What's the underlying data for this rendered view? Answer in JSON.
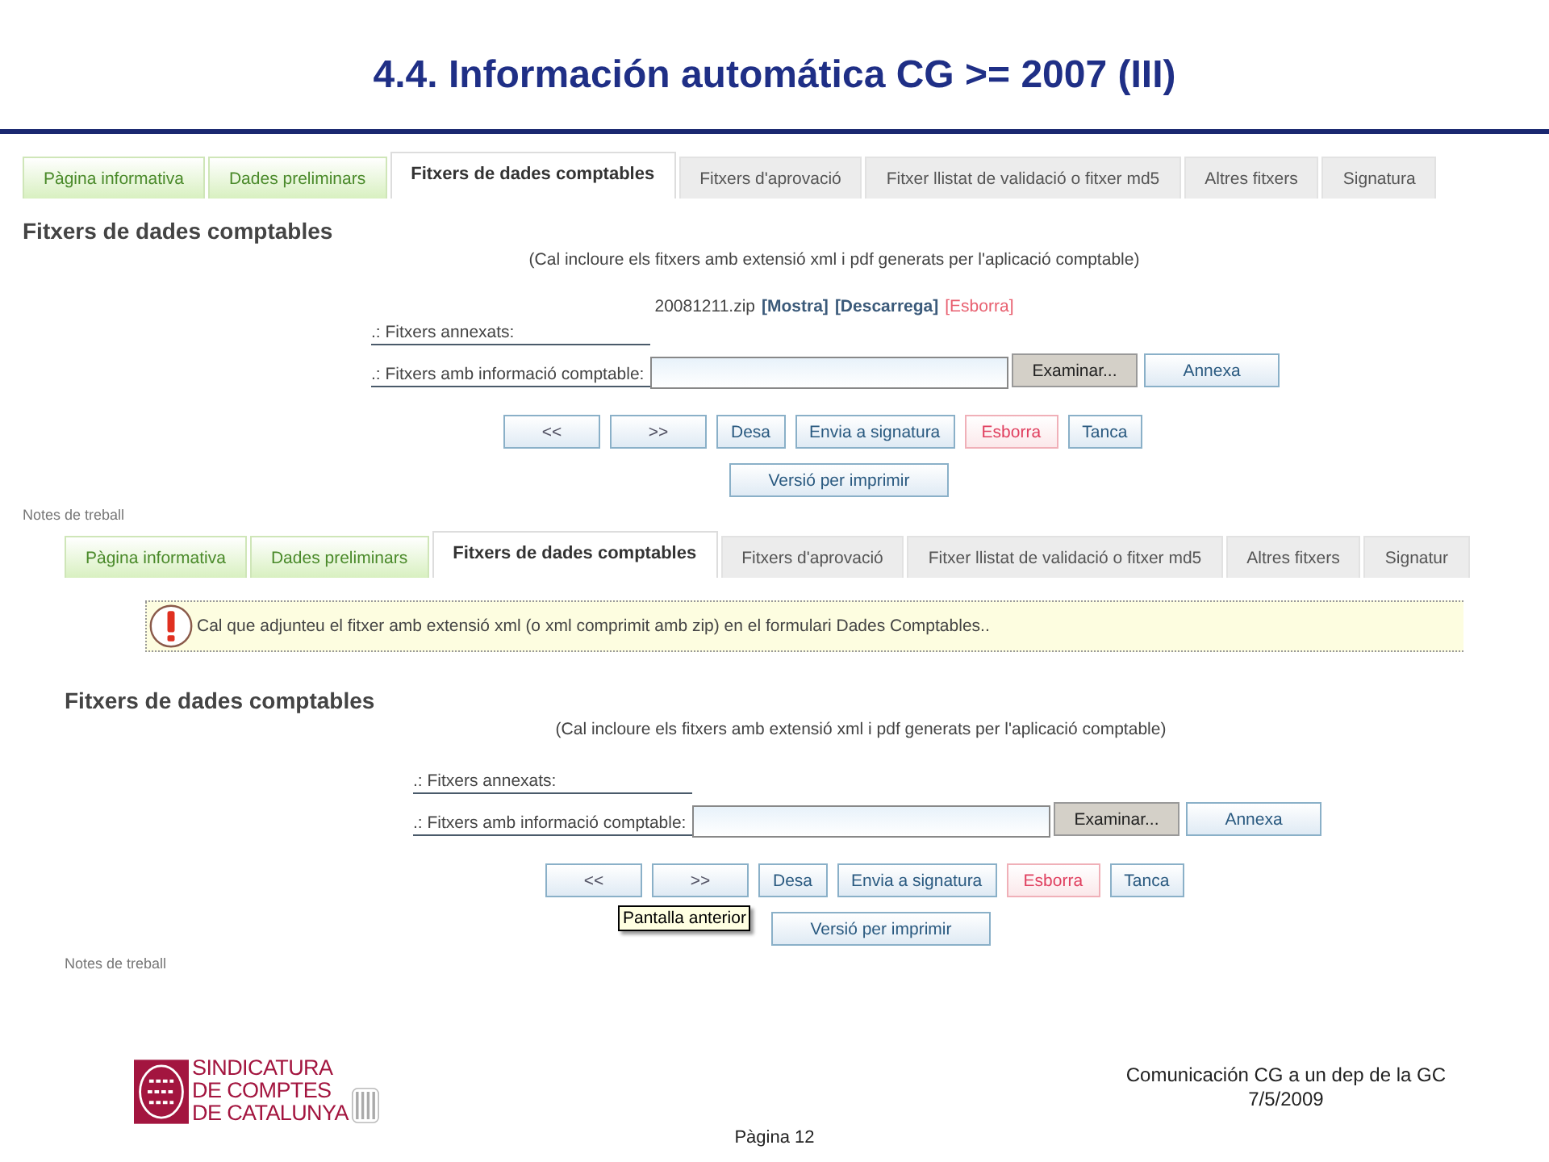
{
  "slide": {
    "title": "4.4. Información automática CG >= 2007 (III)"
  },
  "screenshots": [
    {
      "tabs": [
        {
          "label": "Pàgina informativa",
          "kind": "done",
          "selected": false
        },
        {
          "label": "Dades preliminars",
          "kind": "done",
          "selected": false
        },
        {
          "label": "Fitxers de dades comptables",
          "kind": "todo",
          "selected": true
        },
        {
          "label": "Fitxers d'aprovació",
          "kind": "todo",
          "selected": false
        },
        {
          "label": "Fitxer llistat de validació o fitxer md5",
          "kind": "todo",
          "selected": false
        },
        {
          "label": "Altres fitxers",
          "kind": "todo",
          "selected": false
        },
        {
          "label": "Signatura",
          "kind": "todo",
          "selected": false
        }
      ],
      "heading": "Fitxers de dades comptables",
      "hint": "(Cal incloure els fitxers amb extensió xml i pdf generats per l'aplicació comptable)",
      "file": {
        "name": "20081211.zip",
        "links": [
          {
            "label": "[Mostra]",
            "kind": "normal"
          },
          {
            "label": "[Descarrega]",
            "kind": "normal"
          },
          {
            "label": "[Esborra]",
            "kind": "danger"
          }
        ]
      },
      "fields": [
        ".: Fitxers annexats:",
        ".: Fitxers amb informació comptable:"
      ],
      "browse_button": "Examinar...",
      "attach_button": "Annexa",
      "buttons": [
        {
          "label": "<<",
          "kind": "arrow"
        },
        {
          "label": ">>",
          "kind": "arrow"
        },
        {
          "label": "Desa",
          "kind": "normal"
        },
        {
          "label": "Envia a signatura",
          "kind": "normal"
        },
        {
          "label": "Esborra",
          "kind": "danger"
        },
        {
          "label": "Tanca",
          "kind": "normal"
        }
      ],
      "print_button": "Versió per imprimir",
      "notes": "Notes de treball"
    },
    {
      "tabs": [
        {
          "label": "Pàgina informativa",
          "kind": "done",
          "selected": false
        },
        {
          "label": "Dades preliminars",
          "kind": "done",
          "selected": false
        },
        {
          "label": "Fitxers de dades comptables",
          "kind": "todo",
          "selected": true
        },
        {
          "label": "Fitxers d'aprovació",
          "kind": "todo",
          "selected": false
        },
        {
          "label": "Fitxer llistat de validació o fitxer md5",
          "kind": "todo",
          "selected": false
        },
        {
          "label": "Altres fitxers",
          "kind": "todo",
          "selected": false
        },
        {
          "label": "Signatur",
          "kind": "todo",
          "selected": false
        }
      ],
      "alert": "Cal que adjunteu el fitxer amb extensió xml (o xml comprimit amb zip) en el formulari Dades Comptables..",
      "heading": "Fitxers de dades comptables",
      "hint": "(Cal incloure els fitxers amb extensió xml i pdf generats per l'aplicació comptable)",
      "fields": [
        ".: Fitxers annexats:",
        ".: Fitxers amb informació comptable:"
      ],
      "browse_button": "Examinar...",
      "attach_button": "Annexa",
      "buttons": [
        {
          "label": "<<",
          "kind": "arrow"
        },
        {
          "label": ">>",
          "kind": "arrow"
        },
        {
          "label": "Desa",
          "kind": "normal"
        },
        {
          "label": "Envia a signatura",
          "kind": "normal"
        },
        {
          "label": "Esborra",
          "kind": "danger"
        },
        {
          "label": "Tanca",
          "kind": "normal"
        }
      ],
      "tooltip": "Pantalla anterior",
      "print_button": "Versió per imprimir",
      "notes": "Notes de treball"
    }
  ],
  "footer": {
    "logo_lines": [
      "SINDICATURA",
      "DE COMPTES",
      "DE CATALUNYA"
    ],
    "caption": "Comunicación CG a un dep de la GC",
    "date": "7/5/2009",
    "page": "Pàgina 12"
  }
}
